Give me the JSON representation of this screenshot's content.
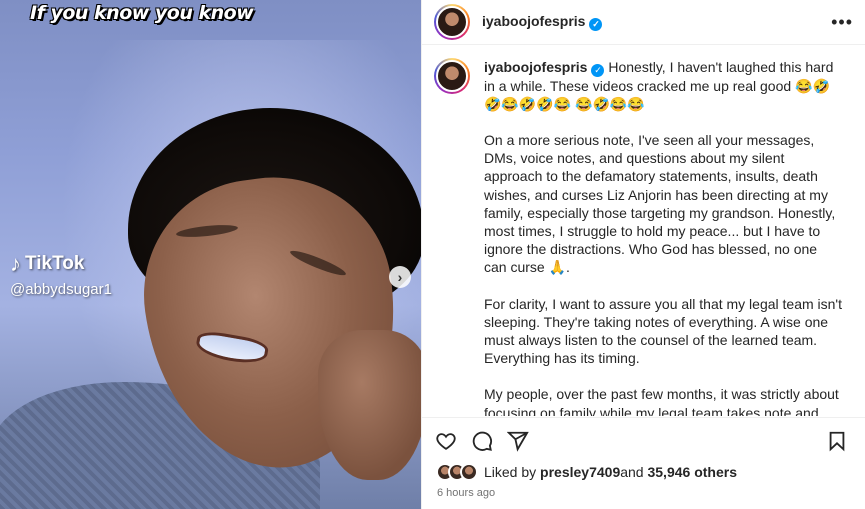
{
  "media": {
    "caption_overlay": "If you know you know",
    "watermark_brand": "TikTok",
    "watermark_handle": "@abbydsugar1",
    "next_arrow": "›"
  },
  "header": {
    "username": "iyaboojofespris",
    "verified_glyph": "✓",
    "more_glyph": "•••"
  },
  "caption": {
    "username": "iyaboojofespris",
    "verified_glyph": "✓",
    "intro": " Honestly, I haven't laughed this hard in a while. These videos cracked me up real good 😂🤣🤣😂🤣🤣😂 😂🤣😂😂",
    "paragraphs": [
      "On a more serious note, I've seen all your messages, DMs, voice notes, and questions about my silent approach to the defamatory statements, insults, death wishes, and curses Liz Anjorin has been directing at my family, especially those targeting my grandson. Honestly, most times, I struggle to hold my peace... but I have to ignore the distractions. Who God has blessed, no one can curse 🙏.",
      "For clarity, I want to assure you all that my legal team isn't sleeping. They're taking notes of everything. A wise one must always listen to the counsel of the learned team. Everything has its timing.",
      "My people, over the past few months, it was strictly about focusing on family while my legal team takes note and prepares me for the battles ahead - welcoming my grandson, supporting my daughter through her motherhood journey, and standing in the gap, both physically and spiritually, required my undivided"
    ]
  },
  "actions": {
    "like_icon": "heart-icon",
    "comment_icon": "comment-icon",
    "share_icon": "paper-plane-icon",
    "save_icon": "bookmark-icon"
  },
  "likes": {
    "prefix": "Liked by ",
    "liker": "presley7409",
    "middle": " and ",
    "others": "35,946 others"
  },
  "timestamp": "6 hours ago"
}
